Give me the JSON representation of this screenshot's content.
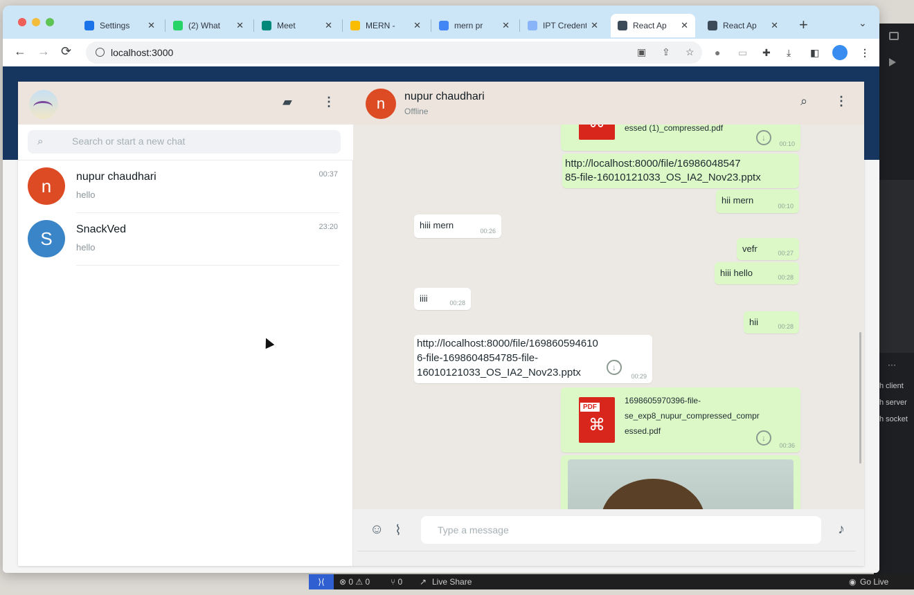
{
  "browser": {
    "tabs": [
      {
        "label": "Settings",
        "color": "#1a73e8"
      },
      {
        "label": "(2) What",
        "color": "#25d366"
      },
      {
        "label": "Meet",
        "color": "#00897b"
      },
      {
        "label": "MERN -",
        "color": "#fbbc04"
      },
      {
        "label": "mern pr",
        "color": "#4285f4"
      },
      {
        "label": "IPT Credent",
        "color": "#8ab4f8"
      },
      {
        "label": "React Ap",
        "color": "#3c4b57",
        "active": true
      },
      {
        "label": "React Ap",
        "color": "#3c4b57"
      }
    ],
    "close_glyph": "✕",
    "new_tab_glyph": "+",
    "tab_menu_glyph": "⌄",
    "url": "localhost:3000",
    "nav": {
      "back": "←",
      "forward": "→",
      "reload": "⟳"
    }
  },
  "sidebar": {
    "search_placeholder": "Search or start a new chat",
    "chats": [
      {
        "avatar_letter": "n",
        "avatar_color": "#dd4b25",
        "name": "nupur chaudhari",
        "last_message": "hello",
        "time": "00:37"
      },
      {
        "avatar_letter": "S",
        "avatar_color": "#3a85c7",
        "name": "SnackVed",
        "last_message": "hello",
        "time": "23:20"
      }
    ]
  },
  "conversation": {
    "contact_letter": "n",
    "contact_name": "nupur chaudhari",
    "status": "Offline",
    "messages": {
      "m1_file": "essed (1)_compressed.pdf",
      "m1_time": "00:10",
      "m2_link_1": "http://localhost:8000/file/16986048547",
      "m2_link_2": "85-file-16010121033_OS_IA2_Nov23.pptx",
      "m3_text": "hii mern",
      "m3_time": "00:10",
      "m4_text": "hiii mern",
      "m4_time": "00:26",
      "m5_text": "vefr",
      "m5_time": "00:27",
      "m6_text": "hiii hello",
      "m6_time": "00:28",
      "m7_text": "iiii",
      "m7_time": "00:28",
      "m8_text": "hii",
      "m8_time": "00:28",
      "m9_link_1": "http://localhost:8000/file/169860594610",
      "m9_link_2": "6-file-1698604854785-file-",
      "m9_link_3": "16010121033_OS_IA2_Nov23.pptx",
      "m9_time": "00:29",
      "m10_line_1": "1698605970396-file-",
      "m10_line_2": "se_exp8_nupur_compressed_compr",
      "m10_line_3": "essed.pdf",
      "m10_time": "00:36",
      "pdf_tag": "PDF"
    },
    "composer_placeholder": "Type a message"
  },
  "statusbar": {
    "problems": "⊗ 0 ⚠ 0",
    "ports": "⑂ 0",
    "live_share": "Live Share",
    "go_live": "Go Live"
  },
  "ide": {
    "lines": [
      "h client",
      "h server",
      "h socket"
    ],
    "dots": "···"
  }
}
